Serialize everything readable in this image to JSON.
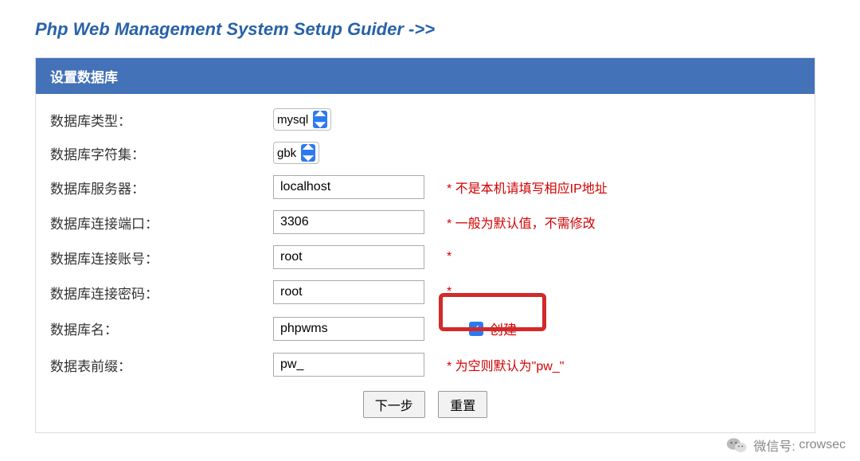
{
  "title": "Php Web Management System Setup Guider ->>",
  "panel_title": "设置数据库",
  "fields": {
    "db_type": {
      "label": "数据库类型：",
      "value": "mysql"
    },
    "charset": {
      "label": "数据库字符集：",
      "value": "gbk"
    },
    "server": {
      "label": "数据库服务器：",
      "value": "localhost",
      "hint": "* 不是本机请填写相应IP地址"
    },
    "port": {
      "label": "数据库连接端口：",
      "value": "3306",
      "hint": "* 一般为默认值，不需修改"
    },
    "user": {
      "label": "数据库连接账号：",
      "value": "root",
      "hint": "*"
    },
    "pass": {
      "label": "数据库连接密码：",
      "value": "root",
      "hint": "*"
    },
    "dbname": {
      "label": "数据库名：",
      "value": "phpwms",
      "create_label": "创建",
      "create_checked": true
    },
    "prefix": {
      "label": "数据表前缀：",
      "value": "pw_",
      "hint": "* 为空则默认为\"pw_\""
    }
  },
  "buttons": {
    "next": "下一步",
    "reset": "重置"
  },
  "footer": {
    "label": "微信号:",
    "value": "crowsec"
  }
}
